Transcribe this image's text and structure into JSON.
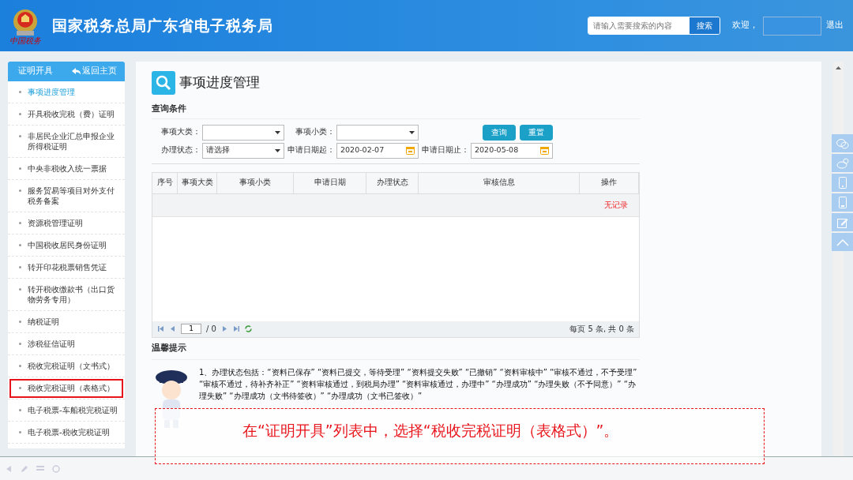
{
  "header": {
    "title": "国家税务总局广东省电子税务局",
    "logo_caption": "中国税务",
    "search": {
      "placeholder": "请输入需要搜索的内容",
      "button": "搜索"
    },
    "welcome": "欢迎，",
    "logout": "退出"
  },
  "sidebar": {
    "title": "证明开具",
    "back": "返回主页",
    "items": [
      {
        "label": "事项进度管理",
        "selected": true,
        "annotated": false
      },
      {
        "label": "开具税收完税（费）证明",
        "selected": false,
        "annotated": false
      },
      {
        "label": "非居民企业汇总申报企业所得税证明",
        "selected": false,
        "annotated": false
      },
      {
        "label": "中央非税收入统一票据",
        "selected": false,
        "annotated": false
      },
      {
        "label": "服务贸易等项目对外支付税务备案",
        "selected": false,
        "annotated": false
      },
      {
        "label": "资源税管理证明",
        "selected": false,
        "annotated": false
      },
      {
        "label": "中国税收居民身份证明",
        "selected": false,
        "annotated": false
      },
      {
        "label": "转开印花税票销售凭证",
        "selected": false,
        "annotated": false
      },
      {
        "label": "转开税收缴款书（出口货物劳务专用）",
        "selected": false,
        "annotated": false
      },
      {
        "label": "纳税证明",
        "selected": false,
        "annotated": false
      },
      {
        "label": "涉税征信证明",
        "selected": false,
        "annotated": false
      },
      {
        "label": "税收完税证明（文书式）",
        "selected": false,
        "annotated": false
      },
      {
        "label": "税收完税证明（表格式）",
        "selected": false,
        "annotated": true
      },
      {
        "label": "电子税票-车船税完税证明",
        "selected": false,
        "annotated": false
      },
      {
        "label": "电子税票-税收完税证明",
        "selected": false,
        "annotated": false
      }
    ]
  },
  "page": {
    "title": "事项进度管理",
    "filter_heading": "查询条件",
    "filters": [
      {
        "label": "事项大类：",
        "kind": "select"
      },
      {
        "label": "事项小类：",
        "kind": "select"
      },
      {
        "label": "办理状态：",
        "kind": "select",
        "value": "请选择"
      },
      {
        "label": "申请日期起：",
        "kind": "date",
        "value": "2020-02-07"
      },
      {
        "label": "申请日期止：",
        "kind": "date",
        "value": "2020-05-08"
      }
    ],
    "buttons": [
      "查询",
      "重置"
    ],
    "table": {
      "columns": [
        "序号",
        "事项大类",
        "事项小类",
        "申请日期",
        "办理状态",
        "审核信息",
        "操作"
      ],
      "empty_text": "无记录"
    },
    "pager": {
      "page": "1",
      "total": "/ 0",
      "summary": "每页 5 条, 共 0 条"
    },
    "tips": {
      "heading": "温馨提示",
      "items": [
        "1、办理状态包括：“资料已保存” “资料已提交，等待受理” “资料提交失败” “已撤销” “资料审核中” “审核不通过，不予受理” “审核不通过，待补齐补正” “资料审核通过，到税局办理” “资料审核通过，办理中” “办理成功” “办理失败（不予同意）” “办理失败” “办理成功（文书待签收）” “办理成功（文书已签收）”"
      ]
    }
  },
  "callout": "在“证明开具”列表中，选择“税收完税证明（表格式）”。"
}
